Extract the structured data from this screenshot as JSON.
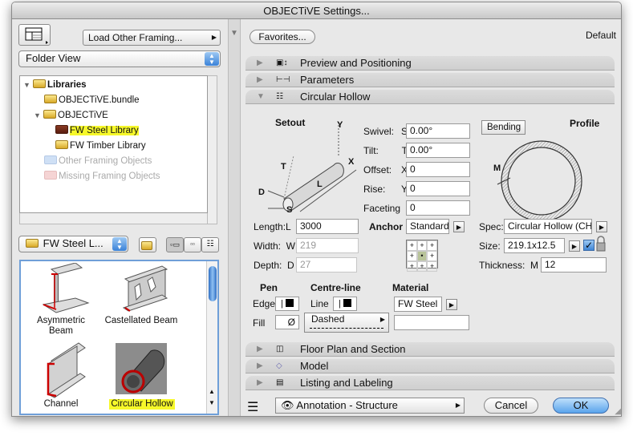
{
  "window": {
    "title": "OBJECTiVE Settings..."
  },
  "left": {
    "load_button": "Load Other Framing...",
    "view_select": "Folder View",
    "tree": [
      {
        "label": "Libraries",
        "expanded": true
      },
      {
        "label": "OBJECTiVE.bundle"
      },
      {
        "label": "OBJECTiVE",
        "expanded": true
      },
      {
        "label": "FW Steel Library",
        "selected": true
      },
      {
        "label": "FW Timber Library"
      },
      {
        "label": "Other Framing Objects",
        "disabled": true
      },
      {
        "label": "Missing Framing Objects",
        "disabled": true
      }
    ],
    "folder_select": "FW Steel L...",
    "objects": [
      {
        "label": "Asymmetric Beam"
      },
      {
        "label": "Castellated Beam"
      },
      {
        "label": "Channel"
      },
      {
        "label": "Circular Hollow",
        "selected": true
      }
    ]
  },
  "right": {
    "favorites": "Favorites...",
    "default_label": "Default",
    "sections": [
      {
        "label": "Preview and Positioning",
        "expanded": false
      },
      {
        "label": "Parameters",
        "expanded": false
      },
      {
        "label": "Circular Hollow",
        "expanded": true
      },
      {
        "label": "Floor Plan and Section",
        "expanded": false
      },
      {
        "label": "Model",
        "expanded": false
      },
      {
        "label": "Listing and Labeling",
        "expanded": false
      }
    ],
    "setout": {
      "title": "Setout",
      "labels": {
        "y": "Y",
        "x": "X",
        "t": "T",
        "l": "L",
        "d": "D",
        "s": "S"
      }
    },
    "angles": [
      {
        "label": "Swivel:",
        "key": "S",
        "value": "0.00°"
      },
      {
        "label": "Tilt:",
        "key": "T",
        "value": "0.00°"
      },
      {
        "label": "Offset:",
        "key": "X",
        "value": "0"
      },
      {
        "label": "Rise:",
        "key": "Y",
        "value": "0"
      },
      {
        "label": "Faceting",
        "key": "",
        "value": "0"
      }
    ],
    "bending": "Bending",
    "profile": {
      "title": "Profile",
      "m_label": "M"
    },
    "dims": [
      {
        "label": "Length:L",
        "value": "3000",
        "disabled": false
      },
      {
        "label": "Width:  W",
        "value": "219",
        "disabled": true
      },
      {
        "label": "Depth:  D",
        "value": "27",
        "disabled": true
      }
    ],
    "anchor": {
      "label": "Anchor",
      "value": "Standard",
      "selected_cell": "center"
    },
    "spec": {
      "label": "Spec:",
      "value": "Circular Hollow (CH"
    },
    "size": {
      "label": "Size:",
      "value": "219.1x12.5",
      "checked": true
    },
    "thickness": {
      "label": "Thickness:  M",
      "value": "12"
    },
    "pen": {
      "title": "Pen",
      "edge": "Edge",
      "fill": "Fill",
      "fill_symbol": "Ø"
    },
    "centre_line": {
      "title": "Centre-line",
      "line": "Line",
      "style": "Dashed"
    },
    "material": {
      "title": "Material",
      "value": "FW Steel",
      "value2": ""
    },
    "layer": "Annotation - Structure",
    "cancel": "Cancel",
    "ok": "OK"
  },
  "colors": {
    "accent": "#5a9ee8",
    "highlight": "#f6f82a"
  }
}
